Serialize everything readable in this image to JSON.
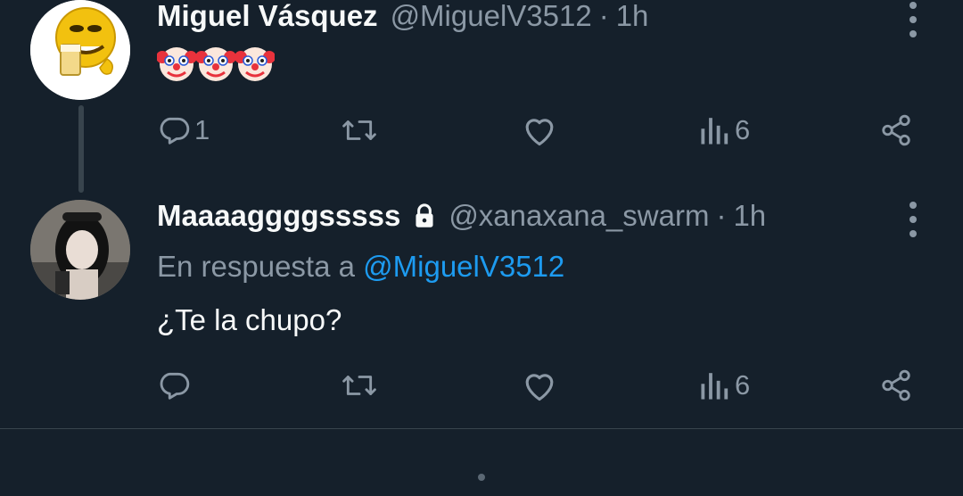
{
  "tweets": [
    {
      "author_name": "Miguel Vásquez",
      "handle": "@MiguelV3512",
      "separator": "·",
      "time": "1h",
      "content_emojis": [
        "🤡",
        "🤡",
        "🤡"
      ],
      "actions": {
        "reply_icon": "reply-icon",
        "reply_count": "1",
        "retweet_icon": "retweet-icon",
        "retweet_count": "",
        "like_icon": "heart-icon",
        "like_count": "",
        "views_icon": "views-icon",
        "views_count": "6",
        "share_icon": "share-icon"
      }
    },
    {
      "author_name": "Maaaaggggsssss",
      "protected_icon": "lock-icon",
      "handle": "@xanaxana_swarm",
      "separator": "·",
      "time": "1h",
      "reply_prefix": "En respuesta a",
      "reply_mention": "@MiguelV3512",
      "text": "¿Te la chupo?",
      "actions": {
        "reply_icon": "reply-icon",
        "reply_count": "",
        "retweet_icon": "retweet-icon",
        "retweet_count": "",
        "like_icon": "heart-icon",
        "like_count": "",
        "views_icon": "views-icon",
        "views_count": "6",
        "share_icon": "share-icon"
      }
    }
  ],
  "colors": {
    "background": "#15202b",
    "primary_text": "#f7f9f9",
    "secondary_text": "#8b98a5",
    "accent": "#1d9bf0",
    "border": "#38444d"
  }
}
